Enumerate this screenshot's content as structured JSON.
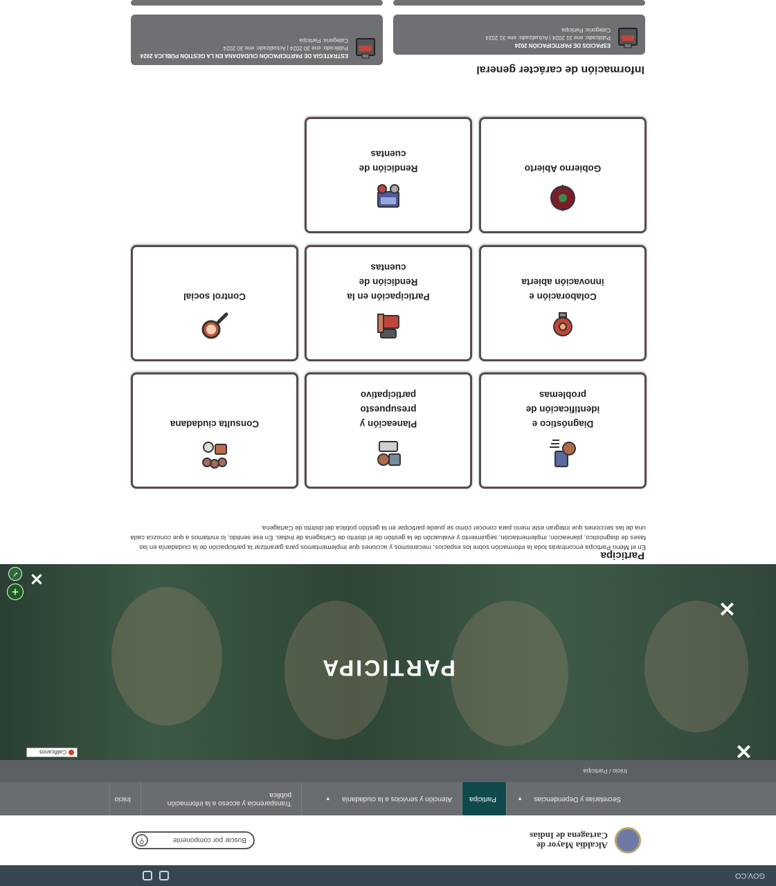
{
  "gov_bar": {
    "label": "GOV.CO"
  },
  "header": {
    "brand": "Alcaldía Mayor de Cartagena de Indias",
    "search_placeholder": "Buscar por componente"
  },
  "nav": {
    "items": [
      {
        "label": "Inicio",
        "active": false,
        "dropdown": false
      },
      {
        "label": "Transparencia y acceso a la información pública",
        "active": false,
        "dropdown": false
      },
      {
        "label": "Atención y servicios a la ciudadanía",
        "active": false,
        "dropdown": true
      },
      {
        "label": "Participa",
        "active": true,
        "dropdown": false
      },
      {
        "label": "Secretarías y Dependencias",
        "active": false,
        "dropdown": true
      }
    ]
  },
  "breadcrumb": "Inicio  /  Participa",
  "hero": {
    "title": "PARTICIPA",
    "rating_badge": "Calificanos"
  },
  "section": {
    "heading": "Participa",
    "intro": "En el Menú Participa encontrarás toda la información sobre los espacios, mecanismos y acciones que implementamos para garantizar la participación de la ciudadanía en las fases de diagnóstico, planeación, implementación, seguimiento y evaluación de la gestión de el distrito de Cartagena de Indias. En ese sentido, lo invitamos a que conozca cada una de las secciones que integran este menú para conocer cómo se puede participar en la gestión pública del distrito de Cartagena."
  },
  "cards": [
    {
      "label": "Diagnóstico e identificación de problemas",
      "icon": "diagnostic-icon"
    },
    {
      "label": "Planeación y presupuesto participativo",
      "icon": "planning-icon"
    },
    {
      "label": "Consulta ciudadana",
      "icon": "consultation-icon"
    },
    {
      "label": "Colaboración e innovación abierta",
      "icon": "innovation-icon"
    },
    {
      "label": "Participación en la Rendición de cuentas",
      "icon": "participation-icon"
    },
    {
      "label": "Control social",
      "icon": "social-control-icon"
    },
    {
      "label": "Gobierno Abierto",
      "icon": "open-government-icon"
    },
    {
      "label": "Rendición de cuentas",
      "icon": "accountability-icon"
    }
  ],
  "info": {
    "heading": "Información de carácter general",
    "documents": [
      {
        "title": "ESPACIOS DE PARTICIPACIÓN 2024",
        "published": "Publicado: ene 31 2024 | Actualizado: ene 31 2024",
        "category": "Categoría: Participa"
      },
      {
        "title": "ESTRATEGIA DE PARTICIPACIÓN CIUDADANA EN LA GESTIÓN PÚBLICA 2024",
        "published": "Publicado: ene 30 2024 | Actualizado: ene 30 2024",
        "category": "Categoría: Participa"
      }
    ]
  },
  "colors": {
    "gov_bar": "#37474f",
    "nav_bg": "#6a6d70",
    "nav_active": "#0f4a4c",
    "card_border": "#5a4a4a",
    "info_card": "#6e7073",
    "fab": "#1d5c1f"
  }
}
